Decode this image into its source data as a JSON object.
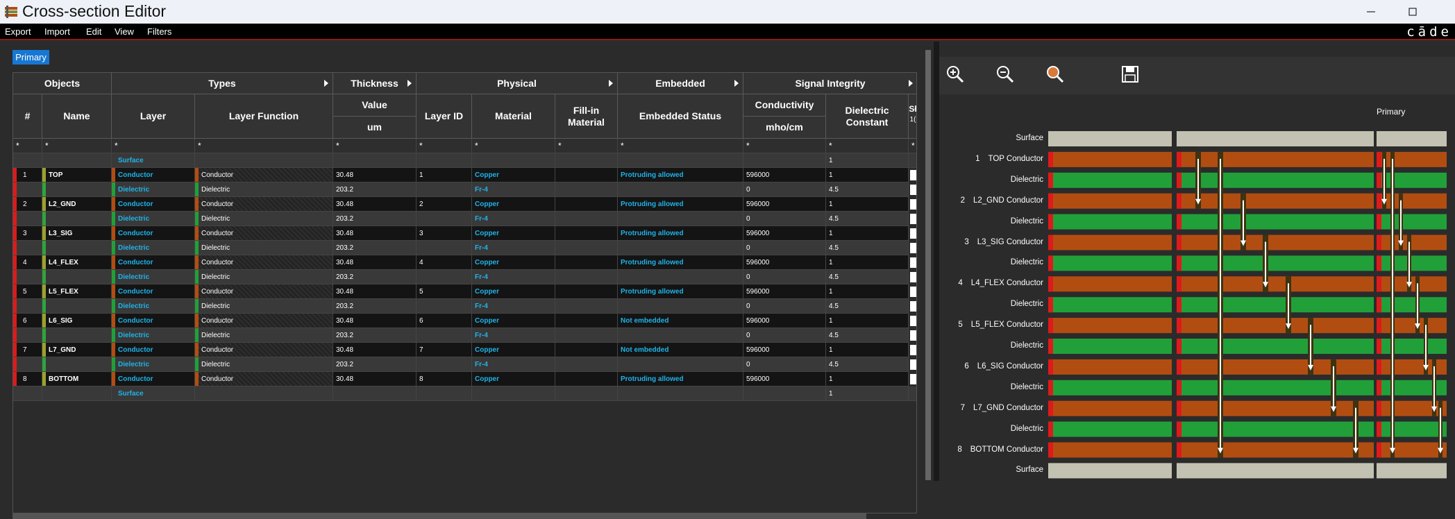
{
  "window": {
    "title": "Cross-section Editor",
    "brand": "cāde"
  },
  "menu": [
    "Export",
    "Import",
    "Edit",
    "View",
    "Filters"
  ],
  "tabs": [
    {
      "label": "Primary",
      "active": true
    }
  ],
  "table": {
    "groups": {
      "objects": "Objects",
      "types": "Types",
      "thickness": "Thickness",
      "physical": "Physical",
      "embedded": "Embedded",
      "signal_integrity": "Signal Integrity"
    },
    "columns": {
      "num": "#",
      "name": "Name",
      "layer": "Layer",
      "layer_function": "Layer Function",
      "value": "Value",
      "unit_um": "um",
      "layer_id": "Layer ID",
      "material": "Material",
      "fillin": "Fill-in Material",
      "embedded_status": "Embedded Status",
      "conductivity": "Conductivity",
      "unit_mho": "mho/cm",
      "dielectric_constant": "Dielectric Constant",
      "cut": "Sł",
      "cut2": "1("
    },
    "filter_glyph": "*",
    "rows": [
      {
        "kind": "surface",
        "num": "",
        "name": "",
        "layer": "Surface",
        "layer_function": "",
        "thickness": "",
        "layer_id": "",
        "material": "",
        "fillin": "",
        "embedded": "",
        "conductivity": "",
        "dk": "1"
      },
      {
        "kind": "conductor",
        "num": "1",
        "name": "TOP",
        "layer": "Conductor",
        "layer_function": "Conductor",
        "thickness": "30.48",
        "layer_id": "1",
        "material": "Copper",
        "fillin": "",
        "embedded": "Protruding allowed",
        "conductivity": "596000",
        "dk": "1"
      },
      {
        "kind": "dielectric",
        "num": "",
        "name": "",
        "layer": "Dielectric",
        "layer_function": "Dielectric",
        "thickness": "203.2",
        "layer_id": "",
        "material": "Fr-4",
        "fillin": "",
        "embedded": "",
        "conductivity": "0",
        "dk": "4.5"
      },
      {
        "kind": "conductor",
        "num": "2",
        "name": "L2_GND",
        "layer": "Conductor",
        "layer_function": "Conductor",
        "thickness": "30.48",
        "layer_id": "2",
        "material": "Copper",
        "fillin": "",
        "embedded": "Protruding allowed",
        "conductivity": "596000",
        "dk": "1"
      },
      {
        "kind": "dielectric",
        "num": "",
        "name": "",
        "layer": "Dielectric",
        "layer_function": "Dielectric",
        "thickness": "203.2",
        "layer_id": "",
        "material": "Fr-4",
        "fillin": "",
        "embedded": "",
        "conductivity": "0",
        "dk": "4.5"
      },
      {
        "kind": "conductor",
        "num": "3",
        "name": "L3_SIG",
        "layer": "Conductor",
        "layer_function": "Conductor",
        "thickness": "30.48",
        "layer_id": "3",
        "material": "Copper",
        "fillin": "",
        "embedded": "Protruding allowed",
        "conductivity": "596000",
        "dk": "1"
      },
      {
        "kind": "dielectric",
        "num": "",
        "name": "",
        "layer": "Dielectric",
        "layer_function": "Dielectric",
        "thickness": "203.2",
        "layer_id": "",
        "material": "Fr-4",
        "fillin": "",
        "embedded": "",
        "conductivity": "0",
        "dk": "4.5"
      },
      {
        "kind": "conductor",
        "num": "4",
        "name": "L4_FLEX",
        "layer": "Conductor",
        "layer_function": "Conductor",
        "thickness": "30.48",
        "layer_id": "4",
        "material": "Copper",
        "fillin": "",
        "embedded": "Protruding allowed",
        "conductivity": "596000",
        "dk": "1"
      },
      {
        "kind": "dielectric",
        "num": "",
        "name": "",
        "layer": "Dielectric",
        "layer_function": "Dielectric",
        "thickness": "203.2",
        "layer_id": "",
        "material": "Fr-4",
        "fillin": "",
        "embedded": "",
        "conductivity": "0",
        "dk": "4.5"
      },
      {
        "kind": "conductor",
        "num": "5",
        "name": "L5_FLEX",
        "layer": "Conductor",
        "layer_function": "Conductor",
        "thickness": "30.48",
        "layer_id": "5",
        "material": "Copper",
        "fillin": "",
        "embedded": "Protruding allowed",
        "conductivity": "596000",
        "dk": "1"
      },
      {
        "kind": "dielectric",
        "num": "",
        "name": "",
        "layer": "Dielectric",
        "layer_function": "Dielectric",
        "thickness": "203.2",
        "layer_id": "",
        "material": "Fr-4",
        "fillin": "",
        "embedded": "",
        "conductivity": "0",
        "dk": "4.5"
      },
      {
        "kind": "conductor",
        "num": "6",
        "name": "L6_SIG",
        "layer": "Conductor",
        "layer_function": "Conductor",
        "thickness": "30.48",
        "layer_id": "6",
        "material": "Copper",
        "fillin": "",
        "embedded": "Not embedded",
        "conductivity": "596000",
        "dk": "1"
      },
      {
        "kind": "dielectric",
        "num": "",
        "name": "",
        "layer": "Dielectric",
        "layer_function": "Dielectric",
        "thickness": "203.2",
        "layer_id": "",
        "material": "Fr-4",
        "fillin": "",
        "embedded": "",
        "conductivity": "0",
        "dk": "4.5"
      },
      {
        "kind": "conductor",
        "num": "7",
        "name": "L7_GND",
        "layer": "Conductor",
        "layer_function": "Conductor",
        "thickness": "30.48",
        "layer_id": "7",
        "material": "Copper",
        "fillin": "",
        "embedded": "Not embedded",
        "conductivity": "596000",
        "dk": "1"
      },
      {
        "kind": "dielectric",
        "num": "",
        "name": "",
        "layer": "Dielectric",
        "layer_function": "Dielectric",
        "thickness": "203.2",
        "layer_id": "",
        "material": "Fr-4",
        "fillin": "",
        "embedded": "",
        "conductivity": "0",
        "dk": "4.5"
      },
      {
        "kind": "conductor",
        "num": "8",
        "name": "BOTTOM",
        "layer": "Conductor",
        "layer_function": "Conductor",
        "thickness": "30.48",
        "layer_id": "8",
        "material": "Copper",
        "fillin": "",
        "embedded": "Protruding allowed",
        "conductivity": "596000",
        "dk": "1"
      },
      {
        "kind": "surface",
        "num": "",
        "name": "",
        "layer": "Surface",
        "layer_function": "",
        "thickness": "",
        "layer_id": "",
        "material": "",
        "fillin": "",
        "embedded": "",
        "conductivity": "",
        "dk": "1"
      }
    ]
  },
  "viewer": {
    "toolbar": [
      {
        "icon": "zoom-in-icon"
      },
      {
        "icon": "zoom-out-icon"
      },
      {
        "icon": "zoom-fit-icon"
      },
      {
        "icon": "save-icon"
      }
    ],
    "view_label": "Primary",
    "layers": [
      {
        "num": "",
        "name": "",
        "type": "Surface",
        "label": "Surface"
      },
      {
        "num": "1",
        "name": "TOP",
        "type": "Conductor",
        "label": "TOP Conductor"
      },
      {
        "num": "",
        "name": "",
        "type": "Dielectric",
        "label": "Dielectric"
      },
      {
        "num": "2",
        "name": "L2_GND",
        "type": "Conductor",
        "label": "L2_GND Conductor"
      },
      {
        "num": "",
        "name": "",
        "type": "Dielectric",
        "label": "Dielectric"
      },
      {
        "num": "3",
        "name": "L3_SIG",
        "type": "Conductor",
        "label": "L3_SIG Conductor"
      },
      {
        "num": "",
        "name": "",
        "type": "Dielectric",
        "label": "Dielectric"
      },
      {
        "num": "4",
        "name": "L4_FLEX",
        "type": "Conductor",
        "label": "L4_FLEX Conductor"
      },
      {
        "num": "",
        "name": "",
        "type": "Dielectric",
        "label": "Dielectric"
      },
      {
        "num": "5",
        "name": "L5_FLEX",
        "type": "Conductor",
        "label": "L5_FLEX Conductor"
      },
      {
        "num": "",
        "name": "",
        "type": "Dielectric",
        "label": "Dielectric"
      },
      {
        "num": "6",
        "name": "L6_SIG",
        "type": "Conductor",
        "label": "L6_SIG Conductor"
      },
      {
        "num": "",
        "name": "",
        "type": "Dielectric",
        "label": "Dielectric"
      },
      {
        "num": "7",
        "name": "L7_GND",
        "type": "Conductor",
        "label": "L7_GND Conductor"
      },
      {
        "num": "",
        "name": "",
        "type": "Dielectric",
        "label": "Dielectric"
      },
      {
        "num": "8",
        "name": "BOTTOM",
        "type": "Conductor",
        "label": "BOTTOM Conductor"
      },
      {
        "num": "",
        "name": "",
        "type": "Surface",
        "label": "Surface"
      }
    ]
  },
  "colors": {
    "conductor": "#b24d12",
    "dielectric": "#21a03a",
    "surface": "#c3c2b2",
    "edge_red": "#e0191a",
    "via": "#3e3310",
    "accent": "#1877d2",
    "link": "#1fb3e8"
  }
}
